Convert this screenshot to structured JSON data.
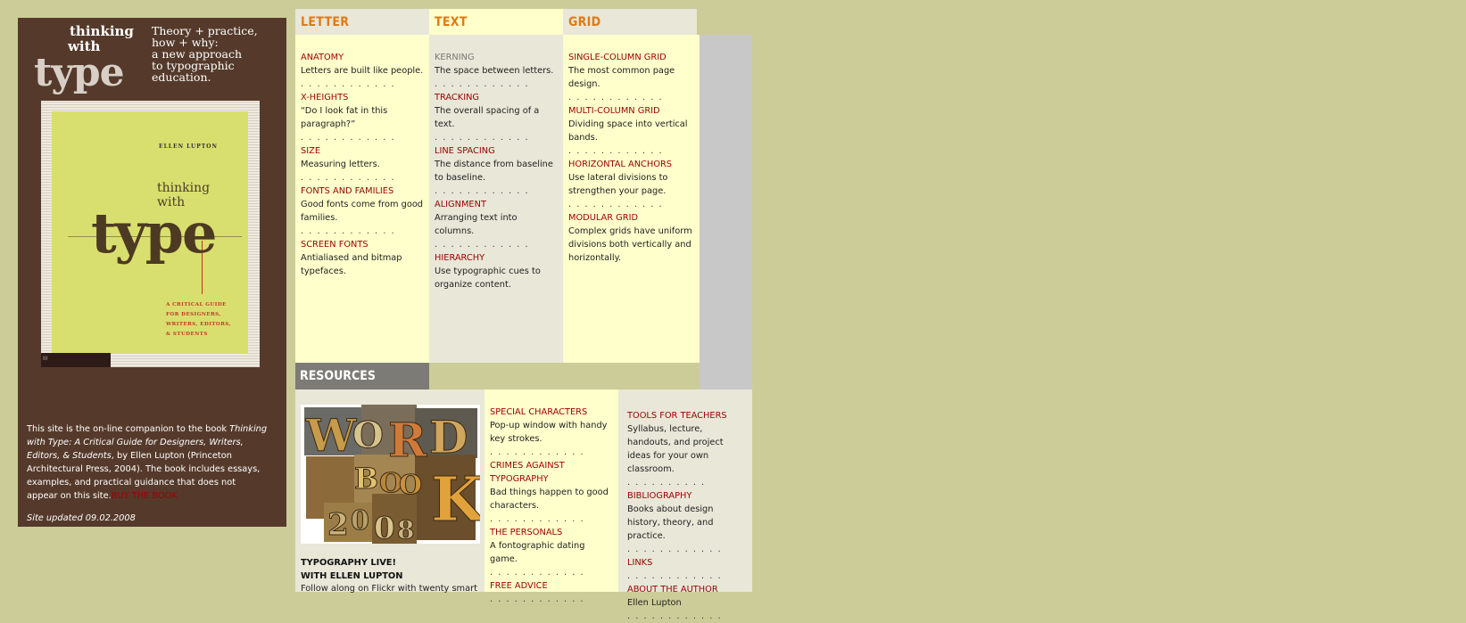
{
  "site": {
    "logo_line1": "thinking",
    "logo_line2": "with",
    "logo_type": "type",
    "tagline": [
      "Theory + practice,",
      "how + why:",
      "a new approach",
      "to typographic",
      "education."
    ]
  },
  "book_cover": {
    "author": "ELLEN LUPTON",
    "title_line1": "thinking",
    "title_line2": "with",
    "title_type": "type",
    "subtitle": [
      "A CRITICAL GUIDE",
      "FOR DESIGNERS,",
      "WRITERS, EDITORS,",
      "& STUDENTS"
    ],
    "bar_mark": "III"
  },
  "info": {
    "intro": "This site is the on-line companion to the book ",
    "book_title": "Thinking with Type: A Critical Guide for Designers, Writers, Editors, & Students",
    "details": ", by Ellen Lupton (Princeton Architectural Press, 2004). The book includes essays, examples, and practical guidance that does not appear on this site.",
    "buy_link": "BUY THE BOOK",
    "updated": "Site updated 09.02.2008"
  },
  "columns": [
    {
      "header": "LETTER",
      "items": [
        {
          "title": "ANATOMY",
          "desc": "Letters are built like people."
        },
        {
          "title": "X-HEIGHTS",
          "desc": "“Do I look fat in this paragraph?”"
        },
        {
          "title": "SIZE",
          "desc": "Measuring letters."
        },
        {
          "title": "FONTS AND FAMILIES",
          "desc": "Good fonts come from good families."
        },
        {
          "title": "SCREEN FONTS",
          "desc": "Antialiased and bitmap typefaces."
        }
      ]
    },
    {
      "header": "TEXT",
      "items": [
        {
          "title": "KERNING",
          "desc": "The space between letters."
        },
        {
          "title": "TRACKING",
          "desc": "The overall spacing of a text."
        },
        {
          "title": "LINE SPACING",
          "desc": "The distance from baseline to baseline."
        },
        {
          "title": "ALIGNMENT",
          "desc": "Arranging text into columns."
        },
        {
          "title": "HIERARCHY",
          "desc": "Use typographic cues to organize content."
        }
      ]
    },
    {
      "header": "GRID",
      "items": [
        {
          "title": "SINGLE-COLUMN GRID",
          "desc": "The most common page design."
        },
        {
          "title": "MULTI-COLUMN GRID",
          "desc": "Dividing space into vertical bands."
        },
        {
          "title": "HORIZONTAL ANCHORS",
          "desc": "Use lateral divisions to strengthen your page."
        },
        {
          "title": "MODULAR GRID",
          "desc": "Complex grids have uniform divisions both vertically and horizontally."
        }
      ]
    }
  ],
  "dots": ". . . . . . . . . . . .",
  "resources": {
    "header": "RESOURCES",
    "wordbook_letters": [
      "W",
      "O",
      "R",
      "D",
      "B",
      "O",
      "O",
      "K",
      "2",
      "0",
      "0",
      "8"
    ],
    "live_title_1": "TYPOGRAPHY LIVE!",
    "live_title_2": "WITH ELLEN LUPTON",
    "live_desc": "Follow along on Flickr with twenty smart",
    "middle": [
      {
        "title": "SPECIAL CHARACTERS",
        "desc": "Pop-up window with handy key strokes."
      },
      {
        "title": "CRIMES AGAINST TYPOGRAPHY",
        "desc": "Bad things happen to good characters."
      },
      {
        "title": "THE PERSONALS",
        "desc": "A fontographic dating game."
      },
      {
        "title": "FREE ADVICE",
        "desc": ""
      }
    ],
    "right": [
      {
        "title": "TOOLS FOR TEACHERS",
        "desc": "Syllabus, lecture, handouts, and project ideas for your own classroom."
      },
      {
        "title": "BIBLIOGRAPHY",
        "desc": "Books about design history, theory, and practice."
      },
      {
        "title": "LINKS",
        "desc": ""
      },
      {
        "title": "ABOUT THE AUTHOR",
        "desc": "Ellen Lupton"
      }
    ]
  },
  "colors": {
    "page_bg": "#cccc99",
    "panel_brown": "#553a2b",
    "header_orange": "#e07a13",
    "link_red": "#990000",
    "pale_yellow": "#ffffcc",
    "pale_gray": "#e8e7d8"
  }
}
